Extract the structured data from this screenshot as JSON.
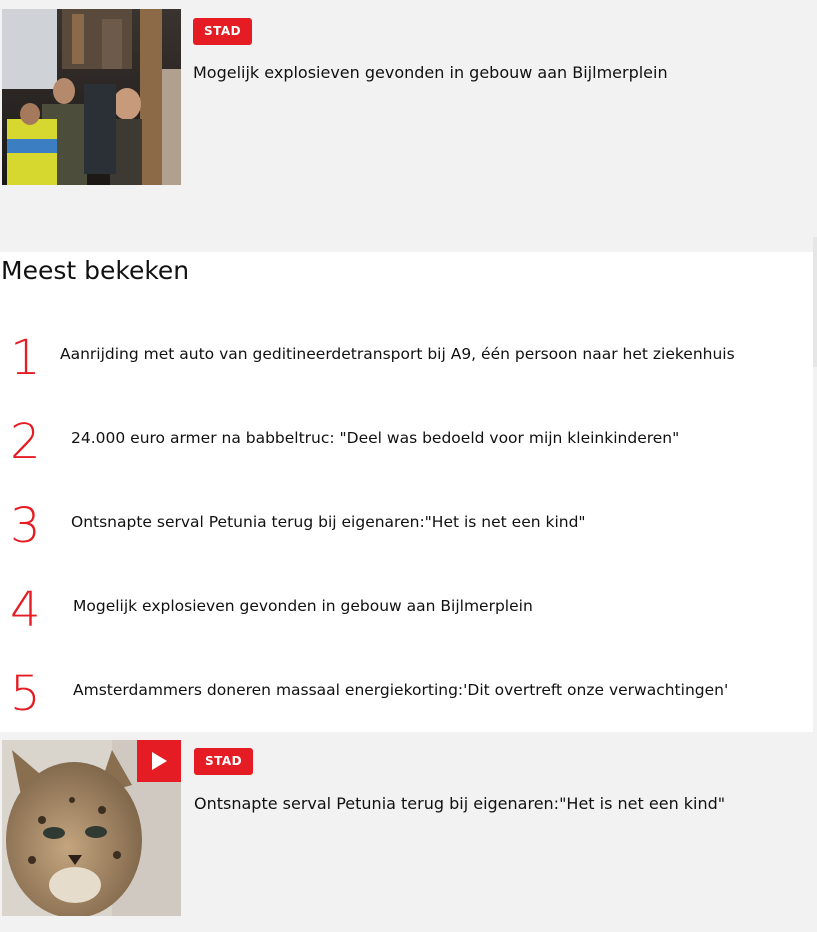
{
  "card_top": {
    "badge": "STAD",
    "headline": "Mogelijk explosieven gevonden in gebouw aan Bijlmerplein"
  },
  "most_viewed": {
    "title": "Meest bekeken",
    "items": [
      {
        "rank": "1",
        "text": "Aanrijding met auto van geditineerdetransport bij A9, één persoon naar het ziekenhuis"
      },
      {
        "rank": "2",
        "text": "24.000 euro armer na babbeltruc: \"Deel was bedoeld voor mijn kleinkinderen\""
      },
      {
        "rank": "3",
        "text": "Ontsnapte serval Petunia terug bij eigenaren:\"Het is net een kind\""
      },
      {
        "rank": "4",
        "text": "Mogelijk explosieven gevonden in gebouw aan Bijlmerplein"
      },
      {
        "rank": "5",
        "text": "Amsterdammers doneren massaal energiekorting:'Dit overtreft onze verwachtingen'"
      }
    ]
  },
  "card_bottom": {
    "badge": "STAD",
    "headline": "Ontsnapte serval Petunia terug bij eigenaren:\"Het is net een kind\"",
    "media_icon": "play-icon"
  },
  "colors": {
    "accent": "#e51c23",
    "page_bg": "#f2f2f2",
    "panel_bg": "#ffffff"
  }
}
